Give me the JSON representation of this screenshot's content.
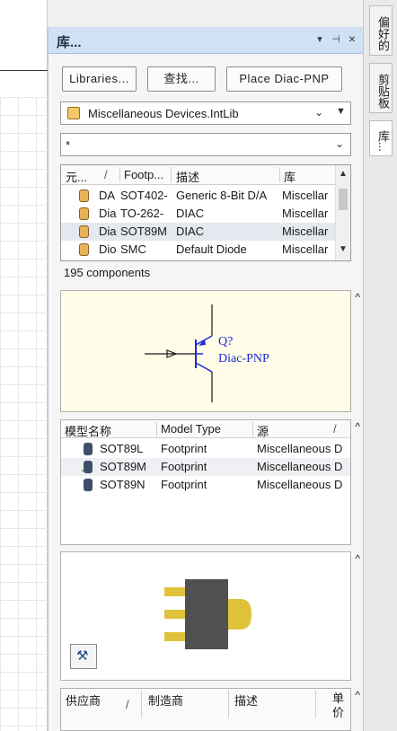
{
  "panel": {
    "title": "库...",
    "menu_icon": "▾",
    "pin_icon": "⊣",
    "close_icon": "×"
  },
  "buttons": {
    "libraries": "Libraries...",
    "search": "查找...",
    "place": "Place Diac-PNP"
  },
  "library_select": {
    "value": "Miscellaneous Devices.IntLib"
  },
  "filter": {
    "value": "*"
  },
  "component_table": {
    "headers": [
      "元...",
      "/",
      "Footp...",
      "描述",
      "库"
    ],
    "rows": [
      {
        "name": "DA",
        "footprint": "SOT402-",
        "description": "Generic 8-Bit D/A",
        "library": "Miscellar"
      },
      {
        "name": "Dia",
        "footprint": "TO-262-",
        "description": "DIAC",
        "library": "Miscellar"
      },
      {
        "name": "Dia",
        "footprint": "SOT89M",
        "description": "DIAC",
        "library": "Miscellar"
      },
      {
        "name": "Dio",
        "footprint": "SMC",
        "description": "Default Diode",
        "library": "Miscellar"
      }
    ],
    "selected_row": 2
  },
  "components_count": "195 components",
  "symbol": {
    "designator": "Q?",
    "comment": "Diac-PNP"
  },
  "model_table": {
    "headers": [
      "模型名称",
      "Model Type",
      "源",
      "/"
    ],
    "rows": [
      {
        "name": "SOT89L",
        "type": "Footprint",
        "source": "Miscellaneous D"
      },
      {
        "name": "SOT89M",
        "type": "Footprint",
        "source": "Miscellaneous D"
      },
      {
        "name": "SOT89N",
        "type": "Footprint",
        "source": "Miscellaneous D"
      }
    ],
    "selected_row": 1
  },
  "supplier_table": {
    "headers": [
      "供应商",
      "/",
      "制造商",
      "描述",
      "单价"
    ]
  },
  "side_tabs": [
    "偏好的",
    "剪贴板",
    "库..."
  ],
  "colors": {
    "titlebar": "#cfe1f3",
    "symbol_bg": "#fffde7",
    "symbol_blue": "#1d2bd6",
    "footprint_gold": "#e0c23a",
    "footprint_body": "#505050"
  }
}
